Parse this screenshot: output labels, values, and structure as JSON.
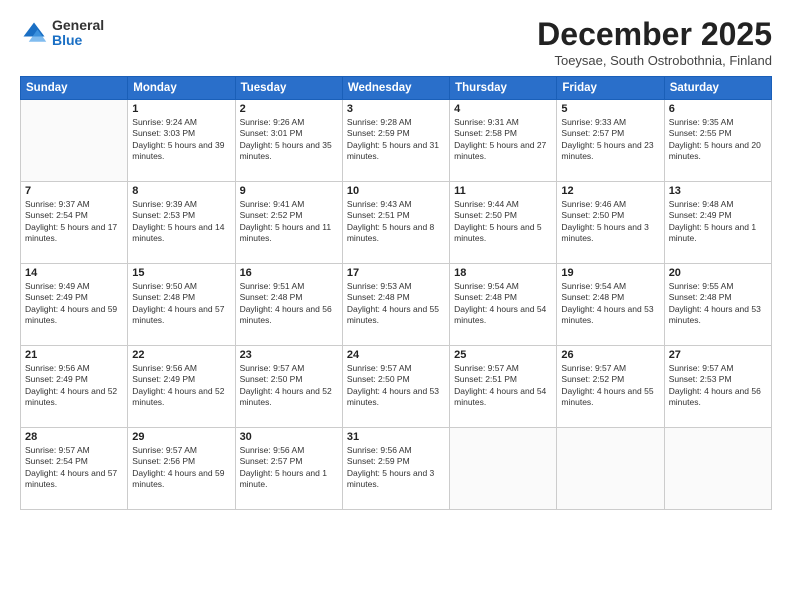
{
  "logo": {
    "general": "General",
    "blue": "Blue"
  },
  "header": {
    "title": "December 2025",
    "subtitle": "Toeysae, South Ostrobothnia, Finland"
  },
  "weekdays": [
    "Sunday",
    "Monday",
    "Tuesday",
    "Wednesday",
    "Thursday",
    "Friday",
    "Saturday"
  ],
  "weeks": [
    [
      {
        "day": "",
        "sunrise": "",
        "sunset": "",
        "daylight": ""
      },
      {
        "day": "1",
        "sunrise": "Sunrise: 9:24 AM",
        "sunset": "Sunset: 3:03 PM",
        "daylight": "Daylight: 5 hours and 39 minutes."
      },
      {
        "day": "2",
        "sunrise": "Sunrise: 9:26 AM",
        "sunset": "Sunset: 3:01 PM",
        "daylight": "Daylight: 5 hours and 35 minutes."
      },
      {
        "day": "3",
        "sunrise": "Sunrise: 9:28 AM",
        "sunset": "Sunset: 2:59 PM",
        "daylight": "Daylight: 5 hours and 31 minutes."
      },
      {
        "day": "4",
        "sunrise": "Sunrise: 9:31 AM",
        "sunset": "Sunset: 2:58 PM",
        "daylight": "Daylight: 5 hours and 27 minutes."
      },
      {
        "day": "5",
        "sunrise": "Sunrise: 9:33 AM",
        "sunset": "Sunset: 2:57 PM",
        "daylight": "Daylight: 5 hours and 23 minutes."
      },
      {
        "day": "6",
        "sunrise": "Sunrise: 9:35 AM",
        "sunset": "Sunset: 2:55 PM",
        "daylight": "Daylight: 5 hours and 20 minutes."
      }
    ],
    [
      {
        "day": "7",
        "sunrise": "Sunrise: 9:37 AM",
        "sunset": "Sunset: 2:54 PM",
        "daylight": "Daylight: 5 hours and 17 minutes."
      },
      {
        "day": "8",
        "sunrise": "Sunrise: 9:39 AM",
        "sunset": "Sunset: 2:53 PM",
        "daylight": "Daylight: 5 hours and 14 minutes."
      },
      {
        "day": "9",
        "sunrise": "Sunrise: 9:41 AM",
        "sunset": "Sunset: 2:52 PM",
        "daylight": "Daylight: 5 hours and 11 minutes."
      },
      {
        "day": "10",
        "sunrise": "Sunrise: 9:43 AM",
        "sunset": "Sunset: 2:51 PM",
        "daylight": "Daylight: 5 hours and 8 minutes."
      },
      {
        "day": "11",
        "sunrise": "Sunrise: 9:44 AM",
        "sunset": "Sunset: 2:50 PM",
        "daylight": "Daylight: 5 hours and 5 minutes."
      },
      {
        "day": "12",
        "sunrise": "Sunrise: 9:46 AM",
        "sunset": "Sunset: 2:50 PM",
        "daylight": "Daylight: 5 hours and 3 minutes."
      },
      {
        "day": "13",
        "sunrise": "Sunrise: 9:48 AM",
        "sunset": "Sunset: 2:49 PM",
        "daylight": "Daylight: 5 hours and 1 minute."
      }
    ],
    [
      {
        "day": "14",
        "sunrise": "Sunrise: 9:49 AM",
        "sunset": "Sunset: 2:49 PM",
        "daylight": "Daylight: 4 hours and 59 minutes."
      },
      {
        "day": "15",
        "sunrise": "Sunrise: 9:50 AM",
        "sunset": "Sunset: 2:48 PM",
        "daylight": "Daylight: 4 hours and 57 minutes."
      },
      {
        "day": "16",
        "sunrise": "Sunrise: 9:51 AM",
        "sunset": "Sunset: 2:48 PM",
        "daylight": "Daylight: 4 hours and 56 minutes."
      },
      {
        "day": "17",
        "sunrise": "Sunrise: 9:53 AM",
        "sunset": "Sunset: 2:48 PM",
        "daylight": "Daylight: 4 hours and 55 minutes."
      },
      {
        "day": "18",
        "sunrise": "Sunrise: 9:54 AM",
        "sunset": "Sunset: 2:48 PM",
        "daylight": "Daylight: 4 hours and 54 minutes."
      },
      {
        "day": "19",
        "sunrise": "Sunrise: 9:54 AM",
        "sunset": "Sunset: 2:48 PM",
        "daylight": "Daylight: 4 hours and 53 minutes."
      },
      {
        "day": "20",
        "sunrise": "Sunrise: 9:55 AM",
        "sunset": "Sunset: 2:48 PM",
        "daylight": "Daylight: 4 hours and 53 minutes."
      }
    ],
    [
      {
        "day": "21",
        "sunrise": "Sunrise: 9:56 AM",
        "sunset": "Sunset: 2:49 PM",
        "daylight": "Daylight: 4 hours and 52 minutes."
      },
      {
        "day": "22",
        "sunrise": "Sunrise: 9:56 AM",
        "sunset": "Sunset: 2:49 PM",
        "daylight": "Daylight: 4 hours and 52 minutes."
      },
      {
        "day": "23",
        "sunrise": "Sunrise: 9:57 AM",
        "sunset": "Sunset: 2:50 PM",
        "daylight": "Daylight: 4 hours and 52 minutes."
      },
      {
        "day": "24",
        "sunrise": "Sunrise: 9:57 AM",
        "sunset": "Sunset: 2:50 PM",
        "daylight": "Daylight: 4 hours and 53 minutes."
      },
      {
        "day": "25",
        "sunrise": "Sunrise: 9:57 AM",
        "sunset": "Sunset: 2:51 PM",
        "daylight": "Daylight: 4 hours and 54 minutes."
      },
      {
        "day": "26",
        "sunrise": "Sunrise: 9:57 AM",
        "sunset": "Sunset: 2:52 PM",
        "daylight": "Daylight: 4 hours and 55 minutes."
      },
      {
        "day": "27",
        "sunrise": "Sunrise: 9:57 AM",
        "sunset": "Sunset: 2:53 PM",
        "daylight": "Daylight: 4 hours and 56 minutes."
      }
    ],
    [
      {
        "day": "28",
        "sunrise": "Sunrise: 9:57 AM",
        "sunset": "Sunset: 2:54 PM",
        "daylight": "Daylight: 4 hours and 57 minutes."
      },
      {
        "day": "29",
        "sunrise": "Sunrise: 9:57 AM",
        "sunset": "Sunset: 2:56 PM",
        "daylight": "Daylight: 4 hours and 59 minutes."
      },
      {
        "day": "30",
        "sunrise": "Sunrise: 9:56 AM",
        "sunset": "Sunset: 2:57 PM",
        "daylight": "Daylight: 5 hours and 1 minute."
      },
      {
        "day": "31",
        "sunrise": "Sunrise: 9:56 AM",
        "sunset": "Sunset: 2:59 PM",
        "daylight": "Daylight: 5 hours and 3 minutes."
      },
      {
        "day": "",
        "sunrise": "",
        "sunset": "",
        "daylight": ""
      },
      {
        "day": "",
        "sunrise": "",
        "sunset": "",
        "daylight": ""
      },
      {
        "day": "",
        "sunrise": "",
        "sunset": "",
        "daylight": ""
      }
    ]
  ]
}
